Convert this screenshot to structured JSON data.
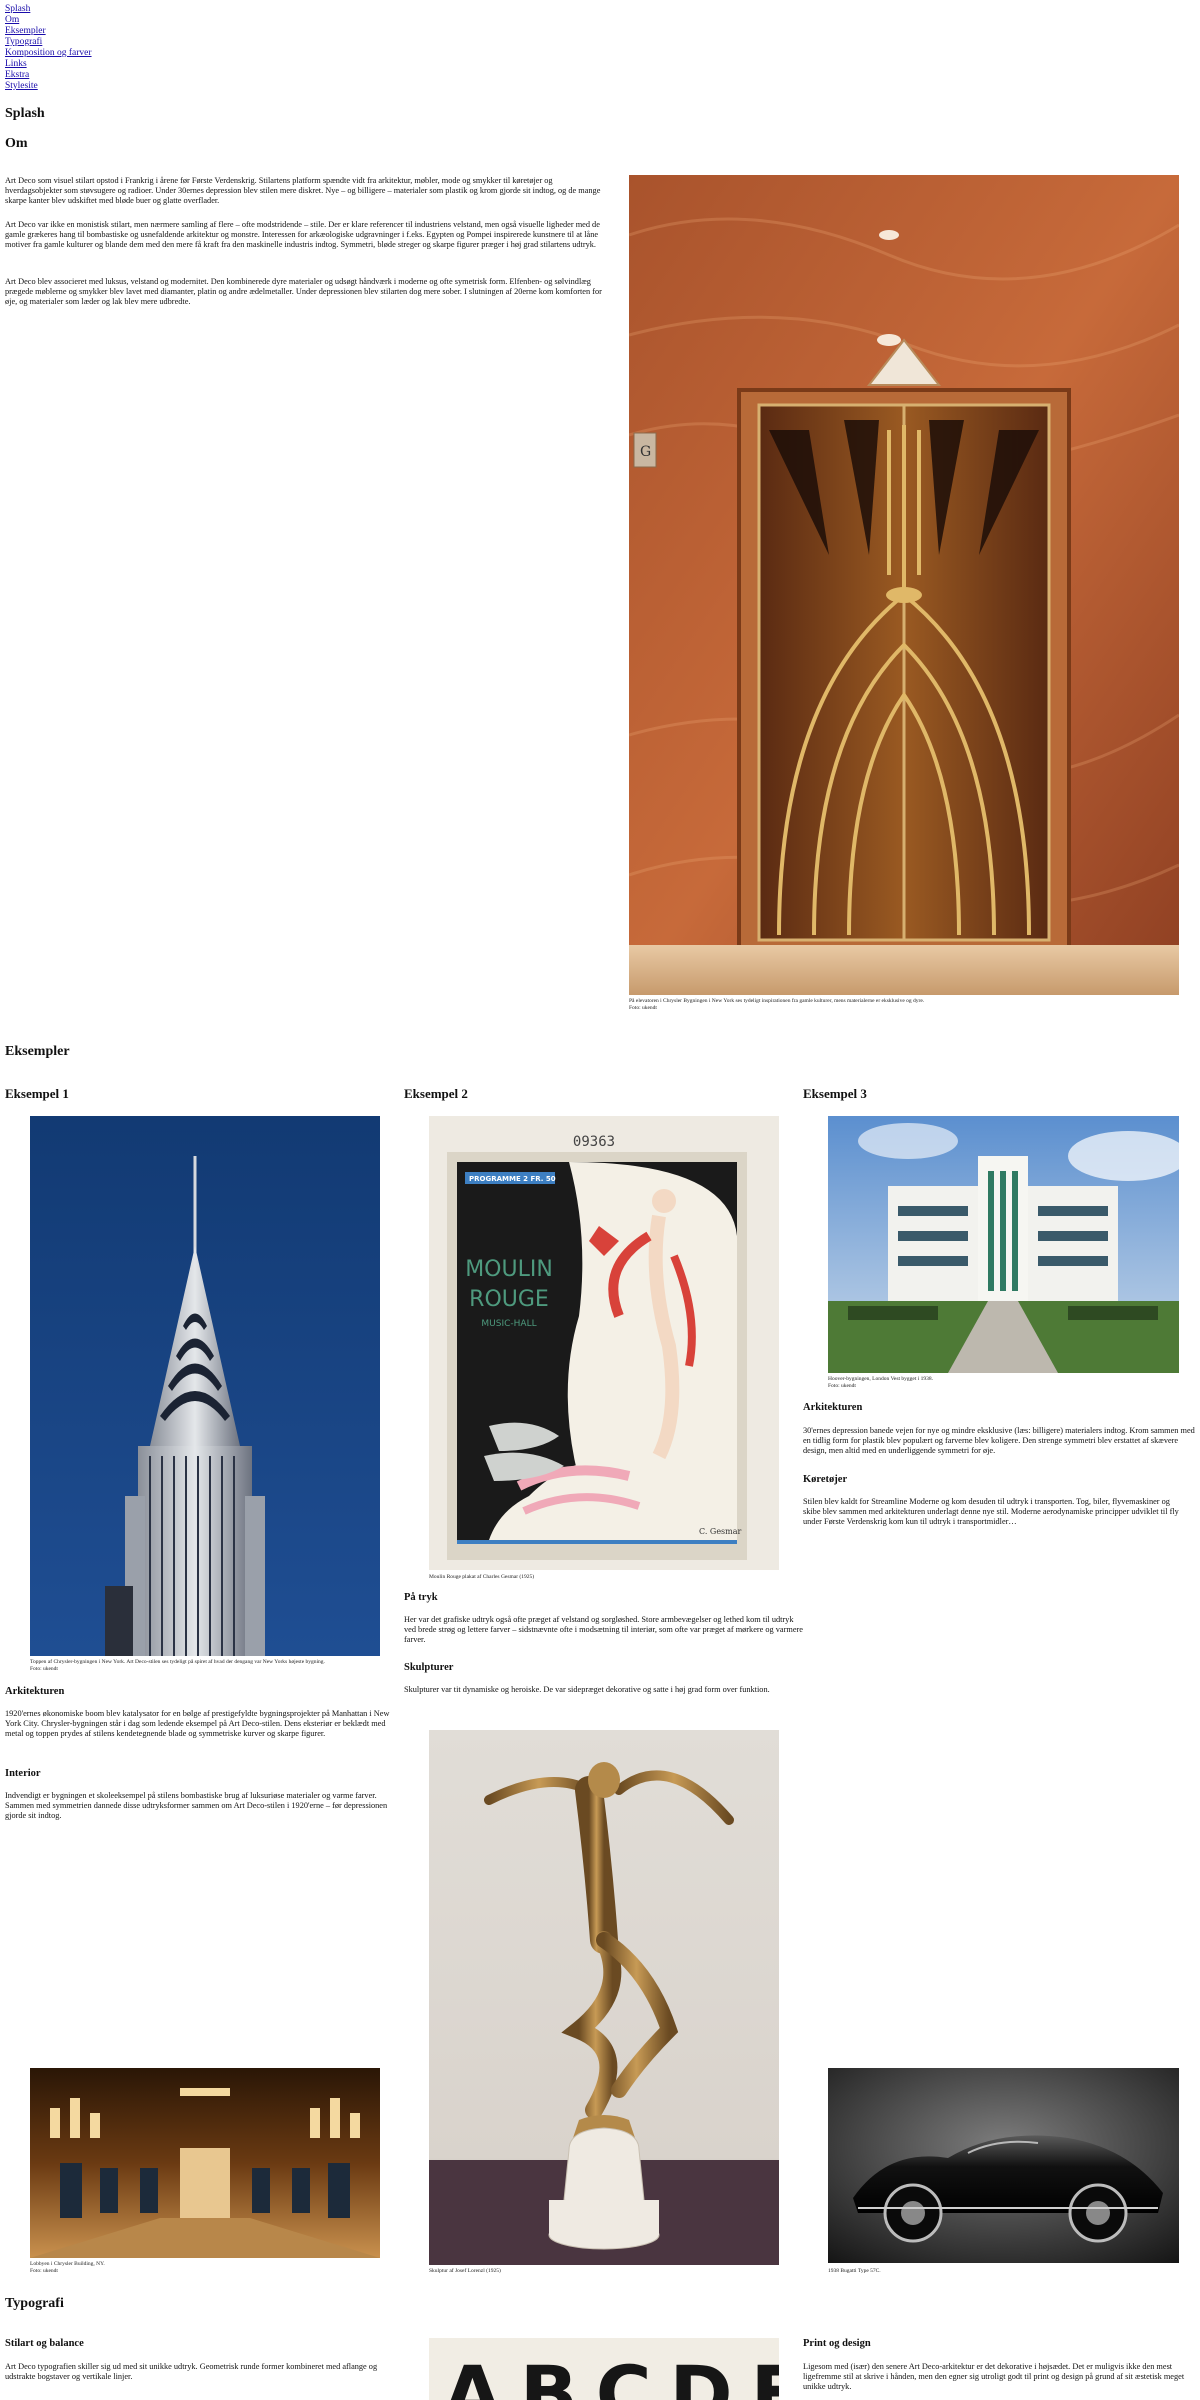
{
  "nav": [
    "Splash",
    "Om",
    "Eksempler",
    "Typografi",
    "Komposition og farver",
    "Links",
    "Ekstra",
    "Stylesite"
  ],
  "sections": {
    "splash": "Splash",
    "om": "Om",
    "eksempler": "Eksempler",
    "typografi": "Typografi"
  },
  "om": {
    "p1": "Art Deco som visuel stilart opstod i Frankrig i årene før Første Verdenskrig. Stilartens platform spændte vidt fra arkitektur, møbler, mode og smykker til køretøjer og hverdagsobjekter som støvsugere og radioer. Under 30ernes depression blev stilen mere diskret. Nye – og billigere – materialer som plastik og krom gjorde sit indtog, og de mange skarpe kanter blev udskiftet med bløde buer og glatte overflader.",
    "p2": "Art Deco var ikke en monistisk stilart, men nærmere samling af flere – ofte modstridende – stile. Der er klare referencer til industriens velstand, men også visuelle ligheder med de gamle grækeres hang til bombastiske og usnefaldende arkitektur og monstre. Interessen for arkæologiske udgravninger i f.eks. Egypten og Pompei inspirerede kunstnere til at låne motiver fra gamle kulturer og blande dem med den mere få kraft fra den maskinelle industris indtog. Symmetri, bløde streger og skarpe figurer præger i høj grad stilartens udtryk.",
    "p3": "Art Deco blev associeret med luksus, velstand og modernitet. Den kombinerede dyre materialer og udsøgt håndværk i moderne og ofte symetrisk form. Elfenben- og sølvindlæg prægede møblerne og smykker blev lavet med diamanter, platin og andre ædelmetaller. Under depressionen blev stilarten dog mere sober. I slutningen af 20erne kom komforten for øje, og materialer som læder og lak blev mere udbredte.",
    "caption": "På elevatoren i Chrysler Bygningen i New York ses tydeligt inspirationen fra gamle kulturer, mens materialerne er eksklusive og dyre.",
    "credit": "Foto: ukendt"
  },
  "ex1": {
    "title": "Eksempel 1",
    "caption": "Toppen af Chrysler-bygningen i New York. Art Deco-stilen ses tydeligt på spiret af hvad der dengang var New Yorks højeste bygning.",
    "credit": "Foto: ukendt",
    "h_arkitektur": "Arkitekturen",
    "p_arkitektur": "1920'ernes økonomiske boom blev katalysator for en bølge af prestigefyldte bygningsprojekter på Manhattan i New York City. Chrysler-bygningen står i dag som ledende eksempel på Art Deco-stilen. Dens eksteriør er beklædt med metal og toppen prydes af stilens kendetegnende blade og symmetriske kurver og skarpe figurer.",
    "h_interior": "Interior",
    "p_interior": "Indvendigt er bygningen et skoleeksempel på stilens bombastiske brug af luksuriøse materialer og varme farver. Sammen med symmetrien dannede disse udtryksformer sammen om Art Deco-stilen i 1920'erne – før depressionen gjorde sit indtog.",
    "lobby_caption": "Lobbyen i Chrysler Building, NY.",
    "lobby_credit": "Foto: ukendt"
  },
  "ex2": {
    "title": "Eksempel 2",
    "poster_number": "09363",
    "poster_programme": "PROGRAMME 2 FR. 50",
    "poster_title1": "MOULIN",
    "poster_title2": "ROUGE",
    "poster_sub": "MUSIC-HALL",
    "poster_sign": "C. Gesmar",
    "caption": "Moulin Rouge plakat af Charles Gesmar (1925)",
    "h_tryk": "På tryk",
    "p_tryk": "Her var det grafiske udtryk også ofte præget af velstand og sorgløshed. Store armbevægelser og lethed kom til udtryk ved brede strøg og lettere farver – sidstnævnte ofte i modsætning til interiør, som ofte var præget af mørkere og varmere farver.",
    "h_skulptur": "Skulpturer",
    "p_skulptur": "Skulpturer var tit dynamiske og heroiske. De var sidepræget dekorative og satte i høj grad form over funktion.",
    "sculpt_caption": "Skulptur af Josef Lorenzl (1925)"
  },
  "ex3": {
    "title": "Eksempel 3",
    "caption": "Hoover-bygningen, London Vest bygget i 1938.",
    "credit": "Foto: ukendt",
    "h_arkitektur": "Arkitekturen",
    "p_arkitektur": "30'ernes depression banede vejen for nye og mindre eksklusive (læs: billigere) materialers indtog. Krom sammen med en tidlig form for plastik blev populært og farverne blev koligere. Den strenge symmetri blev erstattet af skævere design, men altid med en underliggende symmetri for øje.",
    "h_koretojer": "Køretøjer",
    "p_koretojer": "Stilen blev kaldt for Streamline Moderne og kom desuden til udtryk i transporten. Tog, biler, flyvemaskiner og skibe blev sammen med arkitekturen underlagt denne nye stil. Moderne aerodynamiske principper udviklet til fly under Første Verdenskrig kom kun til udtryk i transportmidler…",
    "car_caption": "1938 Bugatti Type 57C."
  },
  "typografi": {
    "h_stilart": "Stilart og balance",
    "p_stilart": "Art Deco typografien skiller sig ud med sit unikke udtryk. Geometrisk runde former kombineret med aflange og udstrakte bogstaver og vertikale linjer.",
    "letters": "ABCDE",
    "h_print": "Print og design",
    "p_print": "Ligesom med (især) den senere Art Deco-arkitektur er det dekorative i højsædet. Det er muligvis ikke den mest ligefremme stil at skrive i hånden, men den egner sig utroligt godt til print og design på grund af sit æstetisk meget unikke udtryk."
  },
  "colors": {
    "link": "#1a0dab",
    "marble": "#c0653a",
    "sky_blue": "#1c3e7a",
    "poster_green": "#4e9a7e",
    "poster_red": "#d8423a"
  }
}
